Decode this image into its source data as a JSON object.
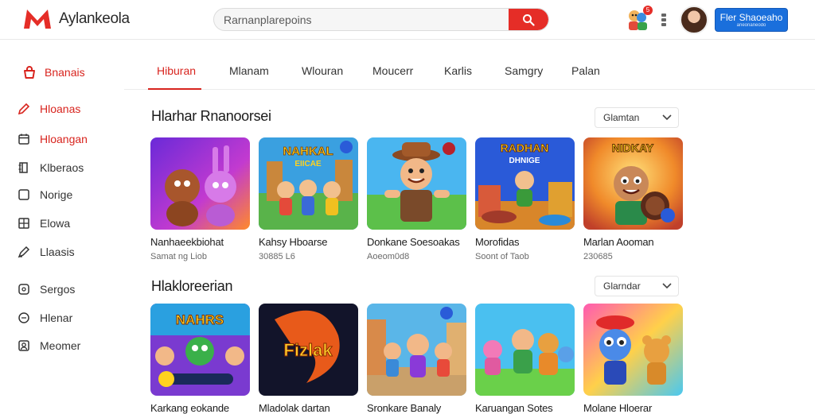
{
  "header": {
    "app_name": "Aylankeola",
    "search_placeholder": "Rarnanplarepoins",
    "notification_count": "5",
    "signin_label": "Fler Shaoeaho",
    "signin_sub": "aneonaneodo"
  },
  "sidebar": {
    "heading": "Bnanais",
    "items": [
      {
        "label": "Hloanas",
        "icon": "pencil-icon"
      },
      {
        "label": "Hloangan",
        "icon": "calendar-icon"
      },
      {
        "label": "Klberaos",
        "icon": "book-icon"
      },
      {
        "label": "Norige",
        "icon": "square-icon"
      },
      {
        "label": "Elowa",
        "icon": "grid-icon"
      },
      {
        "label": "Llaasis",
        "icon": "pen-icon"
      },
      {
        "label": "Sergos",
        "icon": "gear-square-icon"
      },
      {
        "label": "Hlenar",
        "icon": "circle-icon"
      },
      {
        "label": "Meomer",
        "icon": "user-box-icon"
      }
    ]
  },
  "tabs": [
    "Hiburan",
    "Mlanam",
    "Wlouran",
    "Moucerr",
    "Karlis",
    "Samgry",
    "Palan"
  ],
  "sections": [
    {
      "title": "Hlarhar Rnanoorsei",
      "sort": "Glamtan",
      "cards": [
        {
          "title": "Nanhaeekbiohat",
          "meta": "Samat ng Liob"
        },
        {
          "title": "Kahsy Hboarse",
          "meta": "30885 L6"
        },
        {
          "title": "Donkane Soesoakas",
          "meta": "Aoeom0d8"
        },
        {
          "title": "Morofidas",
          "meta": "Soont of Taob"
        },
        {
          "title": "Marlan Aooman",
          "meta": "230685"
        }
      ]
    },
    {
      "title": "Hlakloreerian",
      "sort": "Glarndar",
      "cards": [
        {
          "title": "Karkang eokande",
          "meta": ""
        },
        {
          "title": "Mladolak dartan",
          "meta": ""
        },
        {
          "title": "Sronkare Banaly",
          "meta": ""
        },
        {
          "title": "Karuangan Sotes",
          "meta": ""
        },
        {
          "title": "Molane Hloerar",
          "meta": ""
        }
      ]
    }
  ],
  "thumbnail_text": {
    "s0c1": [
      "NAHKAL",
      "EIICAE"
    ],
    "s0c3": [
      "RADHAN",
      "DHNIGE"
    ],
    "s0c4": [
      "NIDKAY"
    ],
    "s1c0": [
      "NAHRS"
    ],
    "s1c1": [
      "Fizlak"
    ]
  },
  "colors": {
    "accent": "#d8241e",
    "primary_button": "#1a6fdc"
  }
}
